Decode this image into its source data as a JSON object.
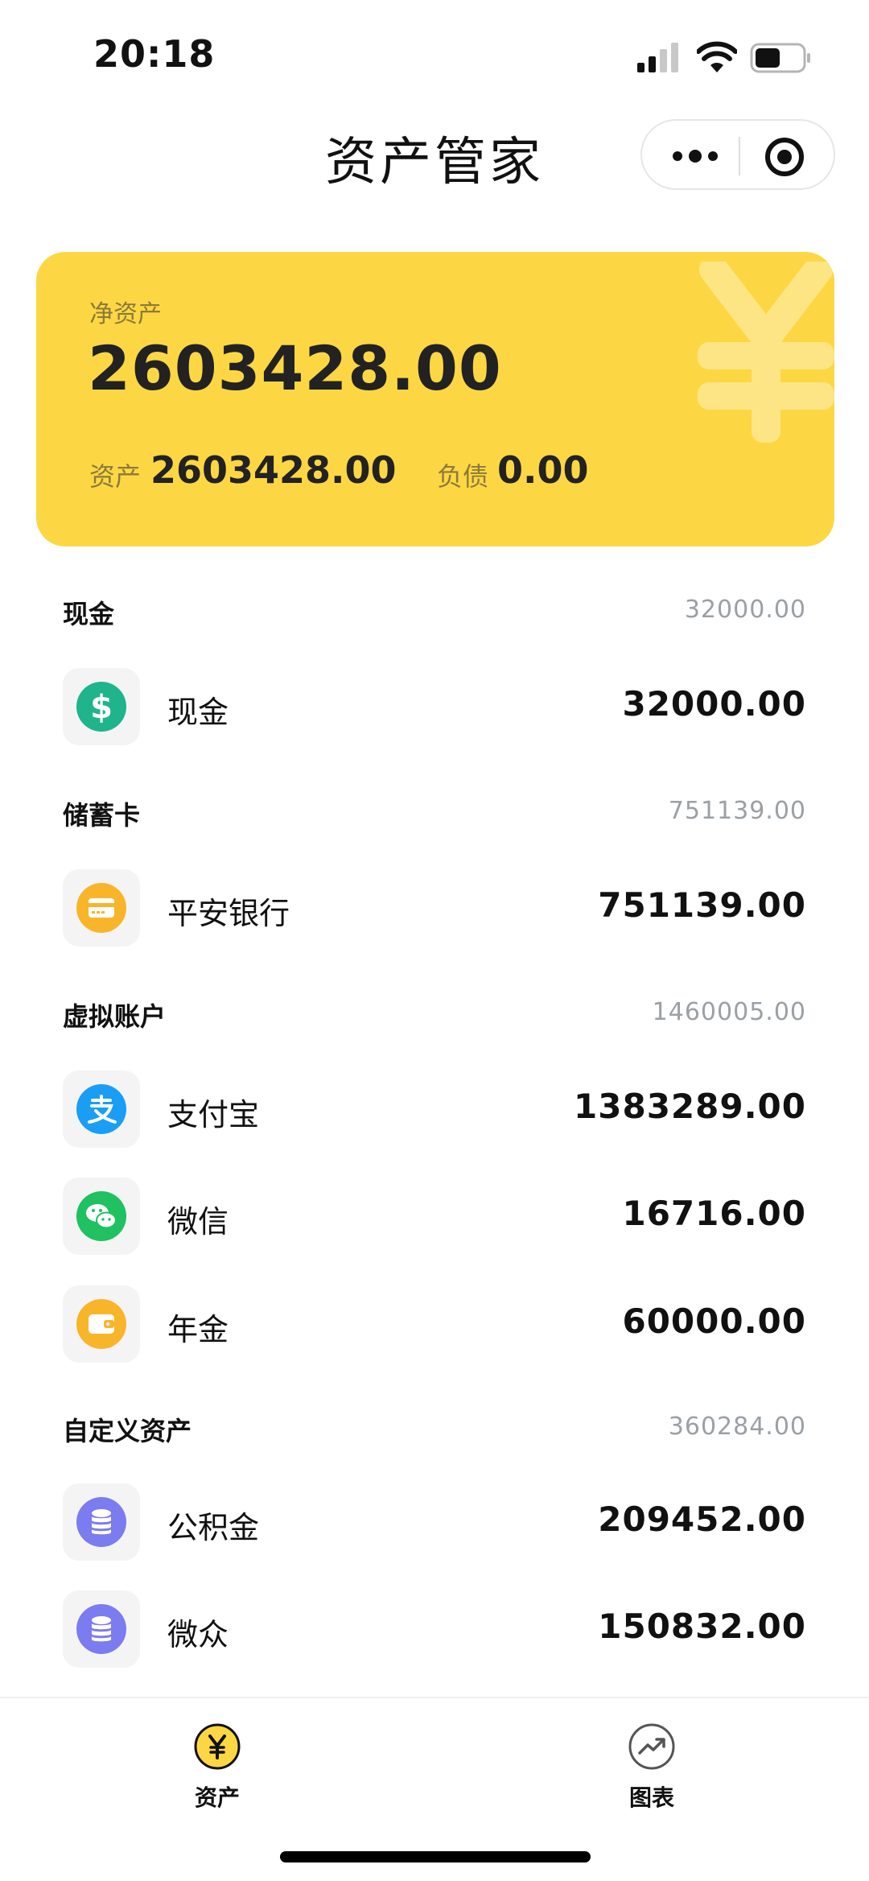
{
  "status_bar": {
    "time": "20:18"
  },
  "header": {
    "title": "资产管家"
  },
  "summary": {
    "net_label": "净资产",
    "net_value": "2603428.00",
    "assets_label": "资产",
    "assets_value": "2603428.00",
    "debt_label": "负债",
    "debt_value": "0.00",
    "card_color": "#fdd743"
  },
  "sections": [
    {
      "title": "现金",
      "total": "32000.00",
      "items": [
        {
          "name": "现金",
          "amount": "32000.00",
          "icon": "dollar-icon",
          "color": "#1fb48c"
        }
      ]
    },
    {
      "title": "储蓄卡",
      "total": "751139.00",
      "items": [
        {
          "name": "平安银行",
          "amount": "751139.00",
          "icon": "card-icon",
          "color": "#f9b52a"
        }
      ]
    },
    {
      "title": "虚拟账户",
      "total": "1460005.00",
      "items": [
        {
          "name": "支付宝",
          "amount": "1383289.00",
          "icon": "alipay-icon",
          "color": "#1a9ef5"
        },
        {
          "name": "微信",
          "amount": "16716.00",
          "icon": "wechat-icon",
          "color": "#1fc160"
        },
        {
          "name": "年金",
          "amount": "60000.00",
          "icon": "wallet-icon",
          "color": "#f9b52a"
        }
      ]
    },
    {
      "title": "自定义资产",
      "total": "360284.00",
      "items": [
        {
          "name": "公积金",
          "amount": "209452.00",
          "icon": "database-icon",
          "color": "#7b7cf0"
        },
        {
          "name": "微众",
          "amount": "150832.00",
          "icon": "database-icon",
          "color": "#7b7cf0"
        }
      ]
    }
  ],
  "tabs": [
    {
      "label": "资产",
      "icon": "yen-coin-icon",
      "active": true
    },
    {
      "label": "图表",
      "icon": "trend-chart-icon",
      "active": false
    }
  ]
}
